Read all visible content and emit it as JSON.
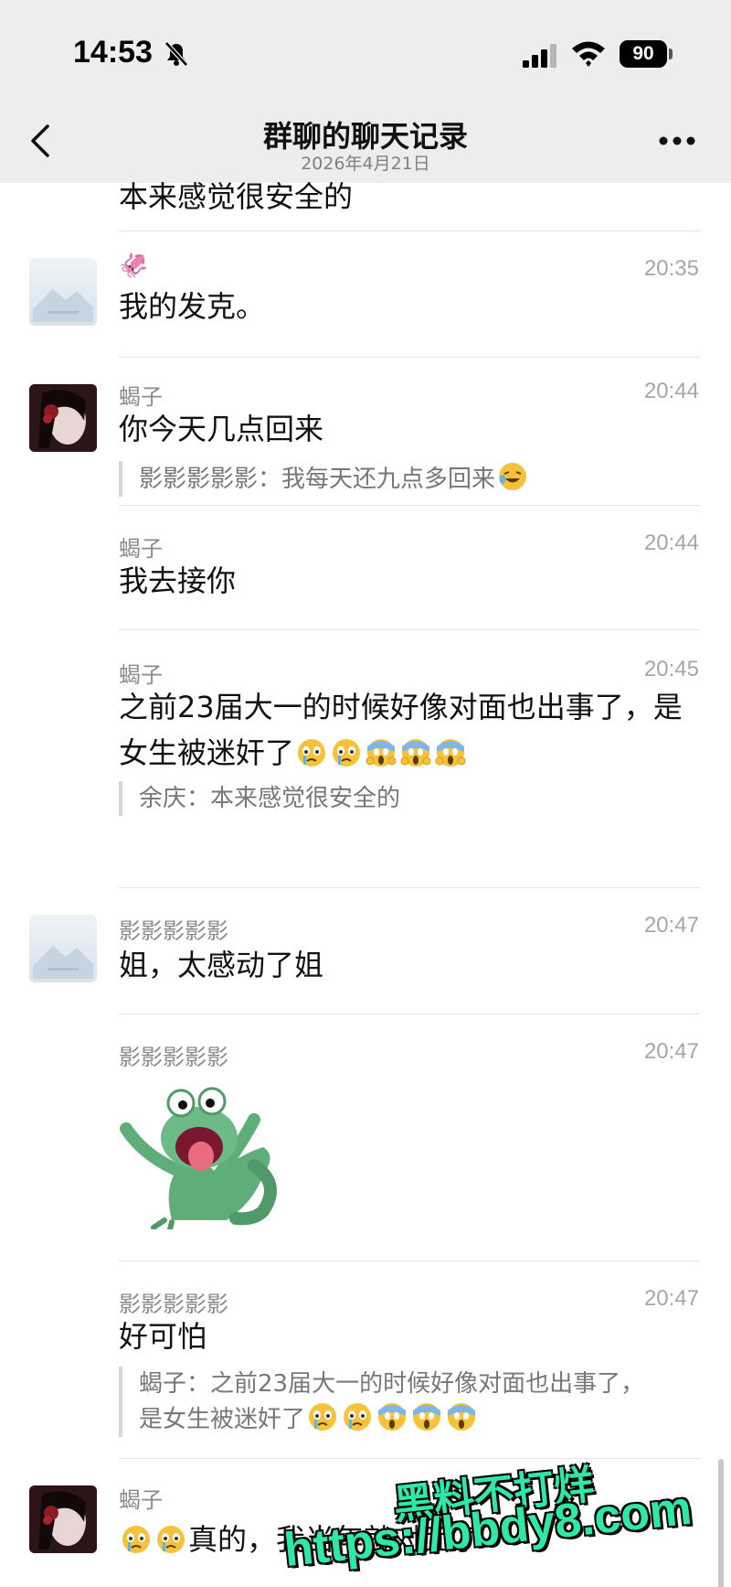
{
  "status_bar": {
    "time": "14:53",
    "battery": "90"
  },
  "nav": {
    "title": "群聊的聊天记录",
    "date": "2026年4月21日"
  },
  "messages": [
    {
      "text": "本来感觉很安全的"
    },
    {
      "sender": "🦑",
      "time": "20:35",
      "text": "我的发克。",
      "avatar": "placeholder"
    },
    {
      "sender": "蝎子",
      "time": "20:44",
      "text": "你今天几点回来",
      "quote": "影影影影影：我每天还九点多回来",
      "avatar": "girl"
    },
    {
      "sender": "蝎子",
      "time": "20:44",
      "text": "我去接你"
    },
    {
      "sender": "蝎子",
      "time": "20:45",
      "text_line1": "之前23届大一的时候好像对面也出事了，是",
      "text_line2": "女生被迷奸了",
      "quote": "余庆：本来感觉很安全的"
    },
    {
      "sender": "影影影影影",
      "time": "20:47",
      "text": "姐，太感动了姐",
      "avatar": "placeholder"
    },
    {
      "sender": "影影影影影",
      "time": "20:47",
      "sticker": "frog-sticker"
    },
    {
      "sender": "影影影影影",
      "time": "20:47",
      "text": "好可怕",
      "quote_line1": "蝎子：之前23届大一的时候好像对面也出事了，",
      "quote_line2": "是女生被迷奸了"
    },
    {
      "sender": "蝎子",
      "text": "真的，我当年就对面了",
      "avatar": "girl"
    }
  ],
  "watermark": {
    "line1": "黑料不打烊",
    "line2": "https://bbdy8.com"
  },
  "colors": {
    "header_bg": "#ededed",
    "watermark": "#2ee8a8"
  }
}
